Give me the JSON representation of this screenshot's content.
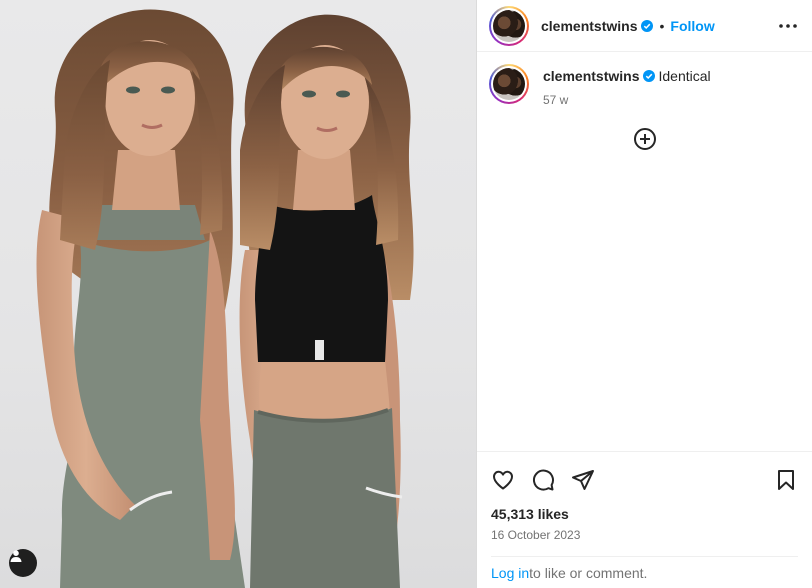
{
  "post": {
    "author": {
      "username": "clementstwins",
      "verified_icon": "verified-badge-icon",
      "follow_label": "Follow",
      "separator": "•"
    },
    "caption": {
      "username": "clementstwins",
      "text": "Identical",
      "time_ago": "57 w"
    },
    "likes_text": "45,313 likes",
    "date": "16 October 2023",
    "login_prompt": {
      "link": "Log in",
      "text": " to like or comment."
    },
    "icons": [
      "heart-icon",
      "comment-icon",
      "share-icon",
      "bookmark-icon",
      "more-options-icon",
      "add-comment-icon",
      "tagged-user-icon"
    ],
    "colors": {
      "accent": "#0095f6",
      "muted": "#737373",
      "text": "#262626"
    }
  }
}
